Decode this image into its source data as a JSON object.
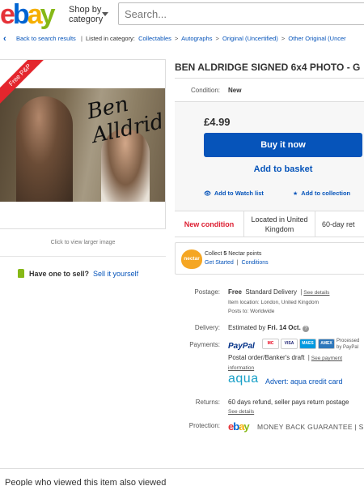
{
  "header": {
    "logo_letters": [
      "e",
      "b",
      "a",
      "y"
    ],
    "logo_colors": [
      "#e53238",
      "#0064d2",
      "#f5af02",
      "#86b817"
    ],
    "shop_by_line1": "Shop by",
    "shop_by_line2": "category",
    "search_placeholder": "Search..."
  },
  "breadcrumb": {
    "back": "Back to search results",
    "listed_in": "Listed in category:",
    "items": [
      "Collectables",
      "Autographs",
      "Original (Uncertified)",
      "Other Original (Uncer"
    ]
  },
  "left": {
    "ribbon": "Free P&P",
    "signature": "Ben Alldridge",
    "click_larger": "Click to view larger image",
    "have_one_prefix": "Have one to sell?",
    "sell_link": "Sell it yourself"
  },
  "item": {
    "title": "BEN ALDRIDGE SIGNED 6x4 PHOTO - G",
    "condition_label": "Condition:",
    "condition_value": "New",
    "price": "£4.99",
    "buy_now": "Buy it now",
    "add_basket": "Add to basket",
    "watch": "Add to Watch list",
    "collection": "Add to collection",
    "info_new": "New condition",
    "info_located_1": "Located in United",
    "info_located_2": "Kingdom",
    "info_returns": "60-day ret"
  },
  "nectar": {
    "logo": "nectar",
    "line1_pre": "Collect ",
    "line1_num": "5",
    "line1_post": " Nectar points",
    "get_started": "Get Started",
    "sep": "|",
    "conditions": "Conditions"
  },
  "details": {
    "postage_label": "Postage:",
    "postage_free": "Free",
    "postage_type": "Standard Delivery",
    "see_details": "See details",
    "item_location": "Item location:  London, United Kingdom",
    "posts_to": "Posts to:  Worldwide",
    "delivery_label": "Delivery:",
    "delivery_pre": "Estimated by ",
    "delivery_date": "Fri. 14 Oct.",
    "payments_label": "Payments:",
    "paypal": "PayPal",
    "card_names": [
      "MC",
      "VISA",
      "MAES",
      "AMEX"
    ],
    "processed_1": "Processed",
    "processed_2": "by PayPal",
    "postal_order": "Postal order/Banker's draft",
    "see_payment": "See payment",
    "information": "information",
    "aqua_logo": "aqua",
    "aqua_ad": "Advert: aqua credit card",
    "returns_label": "Returns:",
    "returns_text": "60 days refund, seller pays return postage",
    "returns_see": "See details",
    "protection_label": "Protection:",
    "mbg": "MONEY BACK GUARANTEE",
    "mbg_sep": "| Se"
  },
  "bottom": {
    "text": "People who viewed this item also viewed"
  }
}
